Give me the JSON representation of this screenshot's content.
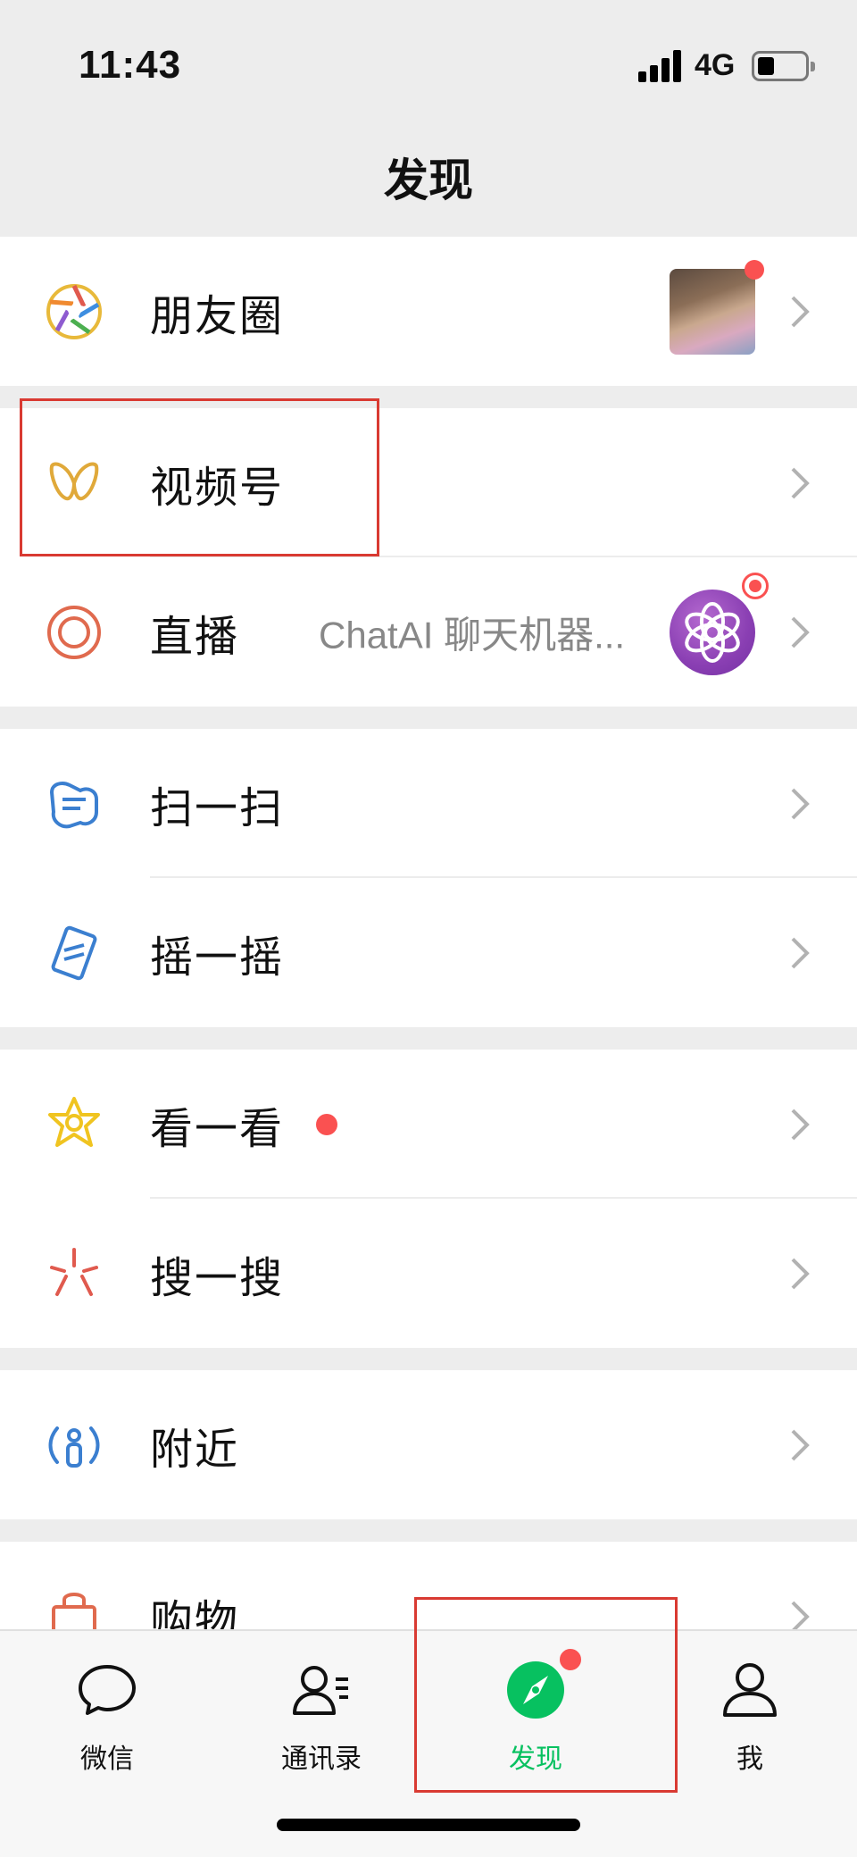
{
  "status_bar": {
    "time": "11:43",
    "network": "4G"
  },
  "header": {
    "title": "发现"
  },
  "sections": {
    "moments": {
      "label": "朋友圈",
      "icon": "moments-aperture-icon"
    },
    "channels": {
      "label": "视频号",
      "icon": "channels-butterfly-icon"
    },
    "live": {
      "label": "直播",
      "subtitle": "ChatAI 聊天机器...",
      "icon": "live-ring-icon"
    },
    "scan": {
      "label": "扫一扫",
      "icon": "scan-icon"
    },
    "shake": {
      "label": "摇一摇",
      "icon": "shake-icon"
    },
    "top_stories": {
      "label": "看一看",
      "icon": "top-stories-star-icon"
    },
    "search": {
      "label": "搜一搜",
      "icon": "search-sparkle-icon"
    },
    "nearby": {
      "label": "附近",
      "icon": "nearby-person-icon"
    },
    "shopping": {
      "label": "购物",
      "icon": "shopping-bag-icon"
    }
  },
  "tab_bar": {
    "tabs": [
      {
        "label": "微信",
        "icon": "chat-bubble-icon"
      },
      {
        "label": "通讯录",
        "icon": "contacts-icon"
      },
      {
        "label": "发现",
        "icon": "discover-compass-icon",
        "active": true
      },
      {
        "label": "我",
        "icon": "me-person-icon"
      }
    ]
  },
  "colors": {
    "accent_green": "#07c160",
    "badge_red": "#fa5151",
    "highlight_red": "#d93a32",
    "background": "#ededed"
  }
}
